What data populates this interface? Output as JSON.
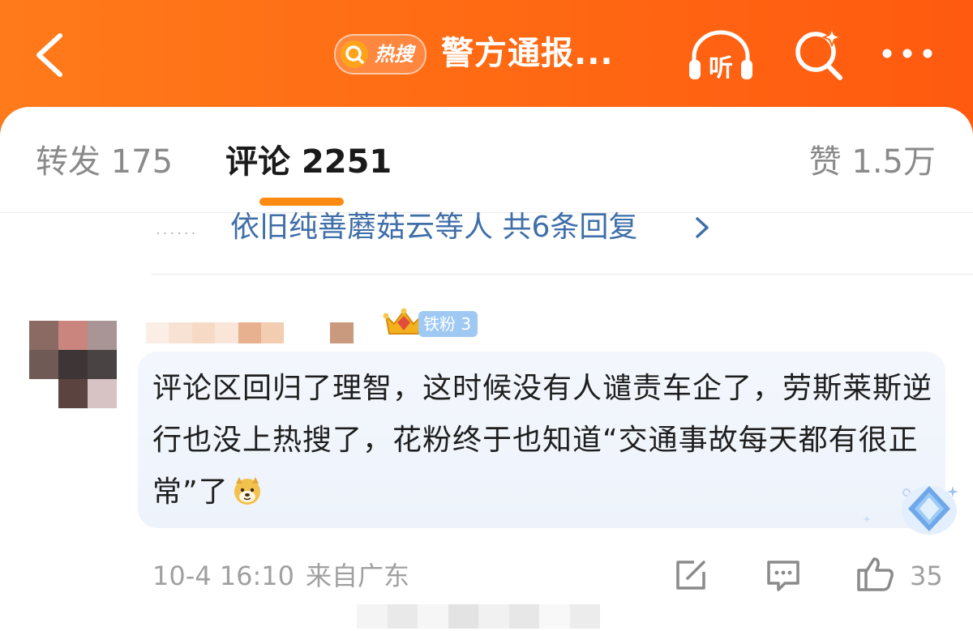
{
  "colors": {
    "brand_orange": "#ff6a13",
    "tab_active_underline": "#ff8a12",
    "link_blue": "#3f6ea8",
    "badge_blue": "#9fc9f2"
  },
  "header": {
    "back_icon": "chevron-left-icon",
    "hot_search_label": "热搜",
    "title": "警方通报...",
    "listen_label": "听",
    "search_icon": "search-sparkle-icon",
    "more_icon": "more-horizontal-icon"
  },
  "tabs": {
    "repost": "转发 175",
    "comment": "评论 2251",
    "like": "赞 1.5万"
  },
  "replies_row": {
    "dots": "······",
    "text": "依旧纯善蘑菇云等人  共6条回复"
  },
  "comment": {
    "fan_badge": "铁粉 3",
    "text": "评论区回归了理智，这时候没有人谴责车企了，劳斯莱斯逆行也没上热搜了，花粉终于也知道“交通事故每天都有很正常”了",
    "emoji_icon": "doge-emoji-icon",
    "time": "10-4 16:10",
    "location": "来自广东",
    "like_count": "35"
  }
}
